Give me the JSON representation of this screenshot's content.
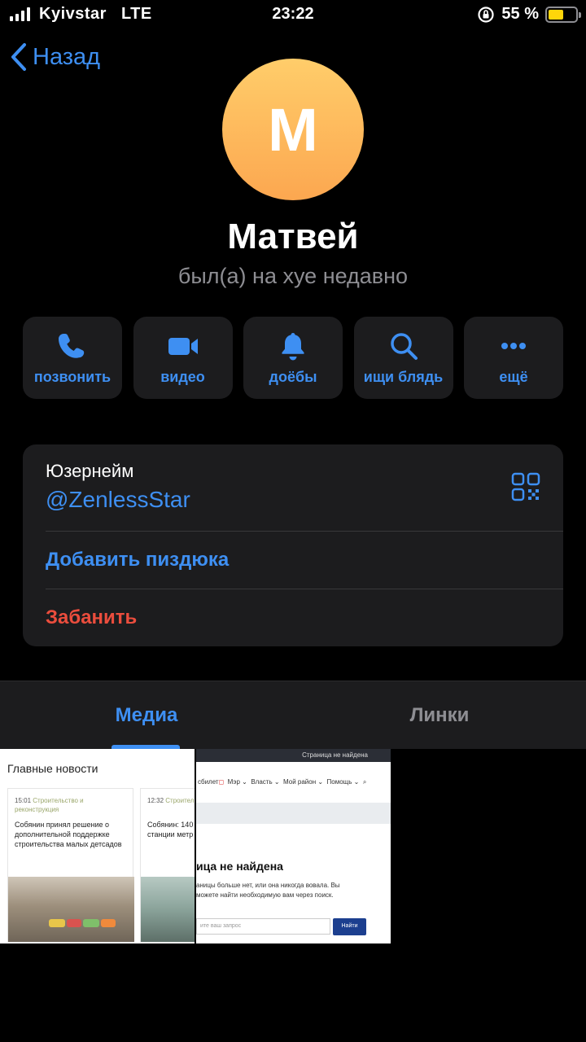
{
  "status_bar": {
    "carrier": "Kyivstar",
    "network": "LTE",
    "time": "23:22",
    "battery_text": "55 %",
    "battery_level": 0.55,
    "battery_color": "#ffd60a"
  },
  "nav": {
    "back_label": "Назад"
  },
  "profile": {
    "avatar_letter": "М",
    "name": "Матвей",
    "status": "был(а) на хуе недавно",
    "avatar_colors": [
      "#ffcd6a",
      "#fca750"
    ]
  },
  "actions": [
    {
      "icon": "phone-icon",
      "label": "позвонить"
    },
    {
      "icon": "video-icon",
      "label": "видео"
    },
    {
      "icon": "bell-icon",
      "label": "доёбы"
    },
    {
      "icon": "search-icon",
      "label": "ищи блядь"
    },
    {
      "icon": "more-icon",
      "label": "ещё"
    }
  ],
  "info": {
    "username_label": "Юзернейм",
    "username_value": "@ZenlessStar",
    "add_contact": "Добавить пиздюка",
    "block": "Забанить"
  },
  "tabs": {
    "media": "Медиа",
    "links": "Линки",
    "active": "media"
  },
  "media": {
    "thumb1": {
      "title": "Главные новости",
      "cards": [
        {
          "time": "15:01",
          "category": "Строительство и реконструкция",
          "text": "Собянин принял решение о дополнительной поддержке строительства малых детсадов"
        },
        {
          "time": "12:32",
          "category": "Строительств",
          "text": "Собянин: 140 пешеходный станции метр «Текстильщ"
        }
      ]
    },
    "thumb2": {
      "topbar": "Страница не найдена",
      "nav_prefix": "сбилет",
      "nav_items": [
        "Мэр ⌄",
        "Власть ⌄",
        "Мой район ⌄",
        "Помощь ⌄"
      ],
      "heading": "ица не найдена",
      "paragraph": "аницы больше нет, или она никогда вовала. Вы можете найти необходимую вам через поиск.",
      "input_placeholder": "ите ваш запрос",
      "button": "Найти"
    }
  },
  "colors": {
    "accent": "#3e8ff2",
    "danger": "#eb4d3d",
    "card_bg": "#1c1c1e"
  }
}
